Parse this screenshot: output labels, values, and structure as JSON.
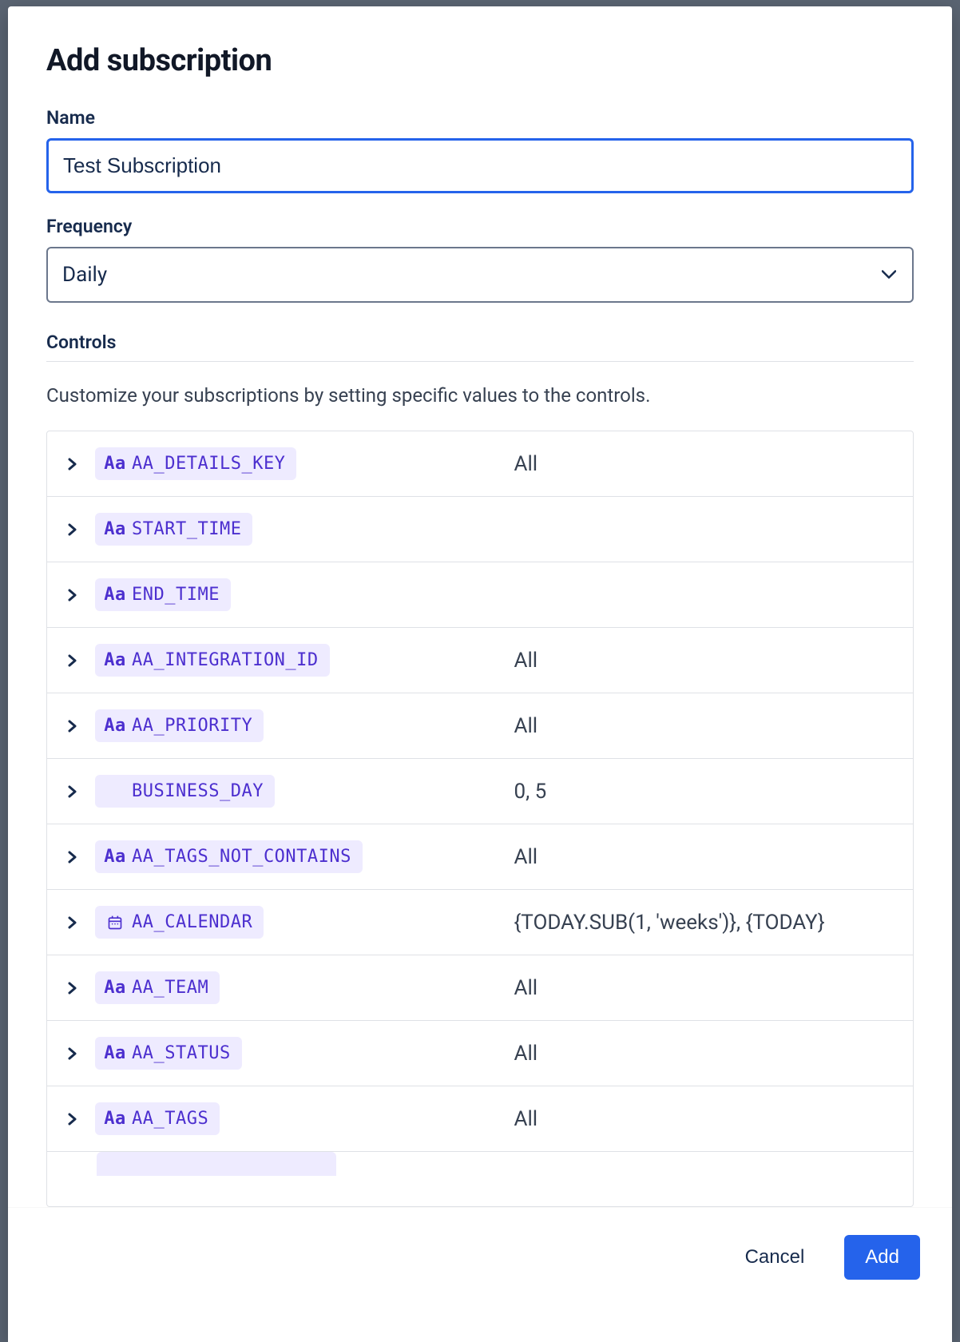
{
  "modal": {
    "title": "Add subscription",
    "name_label": "Name",
    "name_value": "Test Subscription",
    "frequency_label": "Frequency",
    "frequency_value": "Daily",
    "controls_header": "Controls",
    "controls_desc": "Customize your subscriptions by setting specific values to the controls."
  },
  "controls": [
    {
      "icon": "Aa",
      "name": "AA_DETAILS_KEY",
      "value": "All"
    },
    {
      "icon": "Aa",
      "name": "START_TIME",
      "value": ""
    },
    {
      "icon": "Aa",
      "name": "END_TIME",
      "value": ""
    },
    {
      "icon": "Aa",
      "name": "AA_INTEGRATION_ID",
      "value": "All"
    },
    {
      "icon": "Aa",
      "name": "AA_PRIORITY",
      "value": "All"
    },
    {
      "icon": "",
      "name": "BUSINESS_DAY",
      "value": "0, 5"
    },
    {
      "icon": "Aa",
      "name": "AA_TAGS_NOT_CONTAINS",
      "value": "All"
    },
    {
      "icon": "cal",
      "name": "AA_CALENDAR",
      "value": "{TODAY.SUB(1, 'weeks')}, {TODAY}"
    },
    {
      "icon": "Aa",
      "name": "AA_TEAM",
      "value": "All"
    },
    {
      "icon": "Aa",
      "name": "AA_STATUS",
      "value": "All"
    },
    {
      "icon": "Aa",
      "name": "AA_TAGS",
      "value": "All"
    }
  ],
  "footer": {
    "cancel": "Cancel",
    "submit": "Add"
  }
}
